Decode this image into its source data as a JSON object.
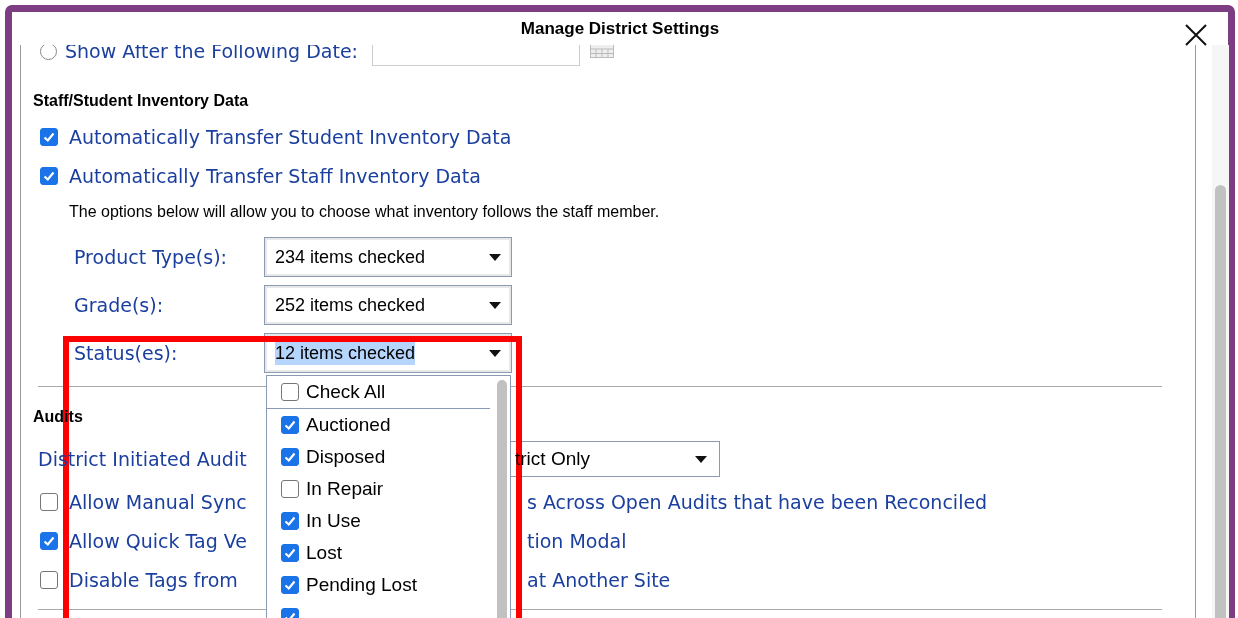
{
  "dialog": {
    "title": "Manage District Settings"
  },
  "date_option": {
    "label": "Show After the Following Date:",
    "selected": false
  },
  "inventory_section": {
    "heading": "Staff/Student Inventory Data",
    "options": [
      {
        "label": "Automatically Transfer Student Inventory Data",
        "checked": true
      },
      {
        "label": "Automatically Transfer Staff Inventory Data",
        "checked": true
      }
    ],
    "description": "The options below will allow you to choose what inventory follows the staff member.",
    "filters": [
      {
        "label": "Product Type(s):",
        "value": "234 items checked",
        "highlighted": false
      },
      {
        "label": "Grade(s):",
        "value": "252 items checked",
        "highlighted": false
      },
      {
        "label": "Status(es):",
        "value": "12 items checked",
        "highlighted": true
      }
    ]
  },
  "status_dropdown": {
    "check_all": {
      "label": "Check All",
      "checked": false
    },
    "items": [
      {
        "label": "Auctioned",
        "checked": true
      },
      {
        "label": "Disposed",
        "checked": true
      },
      {
        "label": "In Repair",
        "checked": false
      },
      {
        "label": "In Use",
        "checked": true
      },
      {
        "label": "Lost",
        "checked": true
      },
      {
        "label": "Pending Lost",
        "checked": true
      },
      {
        "checked": true
      }
    ]
  },
  "audits_section": {
    "heading": "Audits",
    "district_audits": {
      "label": "District Initiated Audit",
      "value": "trict Only"
    },
    "options": [
      {
        "label": "Allow Manual Sync",
        "label_continued": "s Across Open Audits that have been Reconciled",
        "checked": false
      },
      {
        "label": "Allow Quick Tag Ve",
        "label_continued": "tion Modal",
        "checked": true
      },
      {
        "label": "Disable Tags from",
        "label_continued": "at Another Site",
        "checked": false
      }
    ]
  }
}
